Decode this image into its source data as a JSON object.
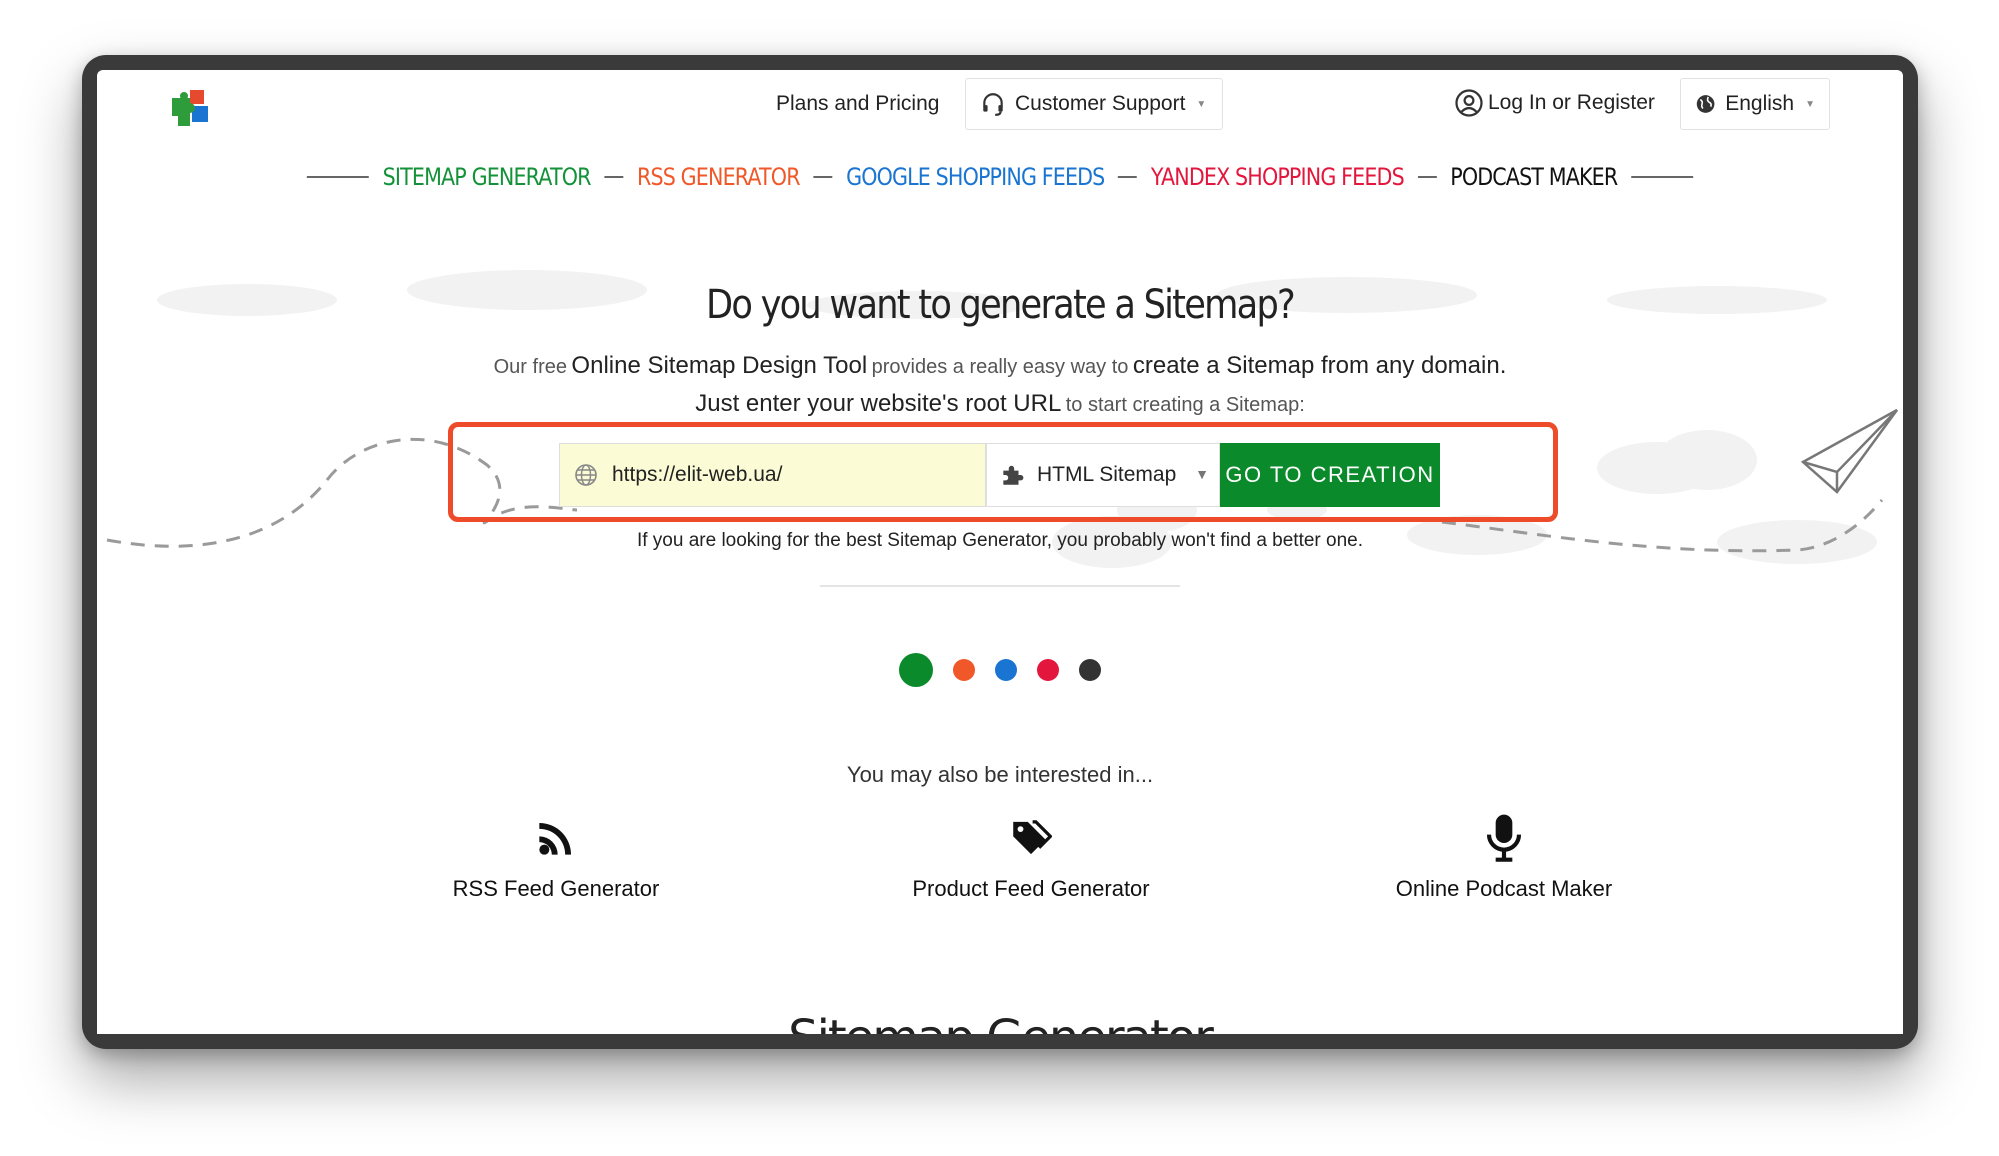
{
  "header": {
    "logo_name": "puzzle-logo",
    "plans_label": "Plans and Pricing",
    "support_label": "Customer Support",
    "login_label": "Log In or Register",
    "language_label": "English"
  },
  "products": [
    {
      "label": "SITEMAP GENERATOR",
      "color": "#14923a"
    },
    {
      "label": "RSS GENERATOR",
      "color": "#f0582a"
    },
    {
      "label": "GOOGLE SHOPPING FEEDS",
      "color": "#1a74d2"
    },
    {
      "label": "YANDEX SHOPPING FEEDS",
      "color": "#e3173d"
    },
    {
      "label": "PODCAST MAKER",
      "color": "#111111"
    }
  ],
  "hero": {
    "title": "Do you want to generate a Sitemap?",
    "line1_a": "Our free",
    "line1_b": "Online Sitemap Design Tool",
    "line1_c": "provides a really easy way to",
    "line1_d": "create a Sitemap from any domain.",
    "line2_a": "Just enter your website's root URL",
    "line2_b": "to start creating a Sitemap:",
    "url_value": "https://elit-web.ua/",
    "sitemap_type": "HTML Sitemap",
    "go_button": "GO TO CREATION",
    "hint": "If you are looking for the best Sitemap Generator, you probably won't find a better one."
  },
  "carousel_dots": [
    {
      "color": "#0a8a2a",
      "active": true
    },
    {
      "color": "#f0582a",
      "active": false
    },
    {
      "color": "#1a74d2",
      "active": false
    },
    {
      "color": "#e3173d",
      "active": false
    },
    {
      "color": "#333333",
      "active": false
    }
  ],
  "interest": {
    "title": "You may also be interested in...",
    "tools": [
      {
        "label": "RSS Feed Generator",
        "icon": "rss-icon"
      },
      {
        "label": "Product Feed Generator",
        "icon": "tag-icon"
      },
      {
        "label": "Online Podcast Maker",
        "icon": "microphone-icon"
      }
    ]
  },
  "next_section_title": "Sitemap Generator"
}
